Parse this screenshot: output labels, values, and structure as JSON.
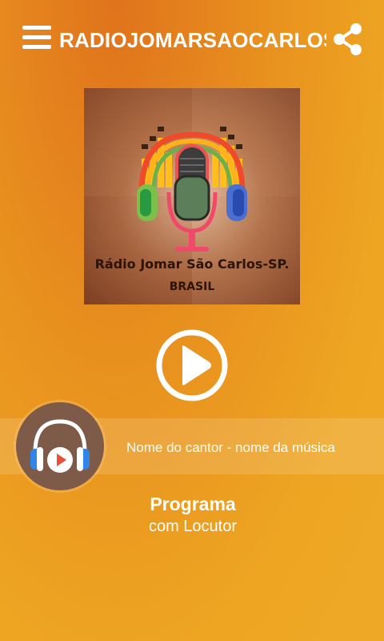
{
  "header": {
    "title": "RADIOJOMARSAOCARLOS",
    "menu_icon": "hamburger-menu-icon",
    "share_icon": "share-icon"
  },
  "artwork": {
    "line1": "Rádio Jomar São Carlos-SP.",
    "line2": "BRASIL"
  },
  "player": {
    "play_icon": "play-icon",
    "now_playing": "Nome do cantor - nome da música",
    "badge_icon": "headphones-play-icon"
  },
  "program": {
    "title": "Programa",
    "host": "com Locutor"
  },
  "colors": {
    "background_top": "#e0731c",
    "background_bottom": "#efa826",
    "badge": "#7e5a49",
    "headphone_blue": "#2f86e8",
    "play_red": "#e8503a"
  }
}
